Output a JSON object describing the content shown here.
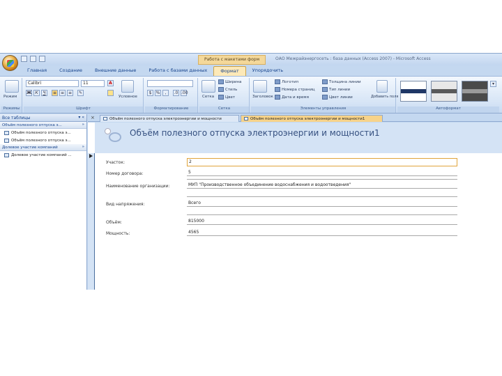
{
  "app": {
    "context_tab": "Работа с макетами форм",
    "window_title": "ОАО Межрайэнергосеть : база данных (Access 2007) - Microsoft Access"
  },
  "ribbon": {
    "tabs": [
      "Главная",
      "Создание",
      "Внешние данные",
      "Работа с базами данных",
      "Формат",
      "Упорядочить"
    ],
    "active_tab": "Формат",
    "groups": {
      "views": "Режимы",
      "font": "Шрифт",
      "formatting": "Форматирование",
      "gridlines": "Сетка",
      "controls": "Элементы управления",
      "autoformat": "Автоформат"
    },
    "views_button": "Режим",
    "font_name": "Calibri",
    "font_size": "11",
    "conditional_label": "Условное",
    "grid_button": "Сетка",
    "grid_items": [
      "Ширина",
      "Стиль",
      "Цвет"
    ],
    "control_items": [
      "Логотип",
      "Номера страниц",
      "Дата и время",
      "Толщина линии",
      "Тип линии",
      "Цвет линии"
    ],
    "add_fields": "Добавить поля",
    "title_button": "Заголовок"
  },
  "nav": {
    "header": "Все таблицы",
    "groups": [
      {
        "label": "Объём полезного отпуска э...",
        "items": [
          "Объём полезного отпуска э...",
          "Объём полезного отпуска э..."
        ]
      },
      {
        "label": "Долевое участие компаний",
        "items": [
          "Долевое участие компаний ..."
        ]
      }
    ]
  },
  "doc_tabs": [
    "Объём полезного отпуска электроэнергии и мощности",
    "Объём полезного отпуска электроэнергии и мощности1"
  ],
  "form": {
    "title": "Объём полезного отпуска электроэнергии и мощности1",
    "fields": [
      {
        "label": "Участок:",
        "value": "2"
      },
      {
        "label": "Номер договора:",
        "value": "5"
      },
      {
        "label": "Наименование организации:",
        "value": "МУП \"Производственное объединение водоснабжения и водоотведения\""
      },
      {
        "label": "Вид напряжения:",
        "value": "Всего"
      },
      {
        "label": "Объём:",
        "value": "815000"
      },
      {
        "label": "Мощность:",
        "value": "4565"
      }
    ]
  }
}
